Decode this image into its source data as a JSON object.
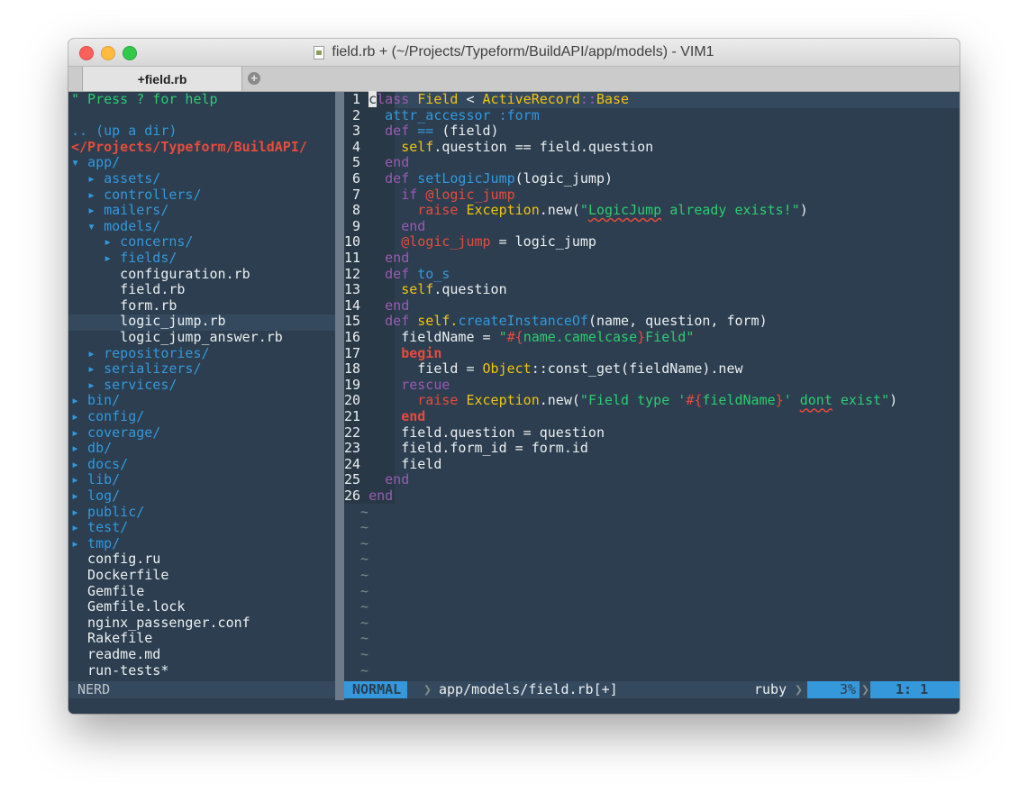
{
  "window": {
    "title": "field.rb + (~/Projects/Typeform/BuildAPI/app/models) - VIM1",
    "tab_label": "+field.rb",
    "add_tab_symbol": "+"
  },
  "tree": {
    "help": "\" Press ? for help",
    "up": ".. (up a dir)",
    "root": "</Projects/Typeform/BuildAPI/",
    "app": "▾ app/",
    "assets": "  ▸ assets/",
    "controllers": "  ▸ controllers/",
    "mailers": "  ▸ mailers/",
    "models": "  ▾ models/",
    "concerns": "    ▸ concerns/",
    "fields": "    ▸ fields/",
    "configuration": "      configuration.rb",
    "field": "      field.rb",
    "form": "      form.rb",
    "logic_jump": "      logic_jump.rb",
    "logic_jump_answer": "      logic_jump_answer.rb",
    "repositories": "  ▸ repositories/",
    "serializers": "  ▸ serializers/",
    "services": "  ▸ services/",
    "bin": "▸ bin/",
    "config": "▸ config/",
    "coverage": "▸ coverage/",
    "db": "▸ db/",
    "docs": "▸ docs/",
    "lib": "▸ lib/",
    "log": "▸ log/",
    "public": "▸ public/",
    "test": "▸ test/",
    "tmp": "▸ tmp/",
    "config_ru": "  config.ru",
    "dockerfile": "  Dockerfile",
    "gemfile": "  Gemfile",
    "gemfile_lock": "  Gemfile.lock",
    "nginx": "  nginx_passenger.conf",
    "rakefile": "  Rakefile",
    "readme": "  readme.md",
    "run_tests": "  run-tests*"
  },
  "code": {
    "ln": [
      " 1",
      " 2",
      " 3",
      " 4",
      " 5",
      " 6",
      " 7",
      " 8",
      " 9",
      "10",
      "11",
      "12",
      "13",
      "14",
      "15",
      "16",
      "17",
      "18",
      "19",
      "20",
      "21",
      "22",
      "23",
      "24",
      "25",
      "26"
    ],
    "t": {
      "sp1": " ",
      "sp2": "   ",
      "sp3": "     ",
      "sp4": "       ",
      "c": "c",
      "lass": "lass",
      "class_sp": " ",
      "field_cls": "Field",
      "lt": " < ",
      "ar": "ActiveRecord",
      "cc": "::",
      "base": "Base",
      "attr_accessor": "attr_accessor",
      "sym_form": ":form",
      "def": "def",
      "eqeq": "==",
      "field_arg": " (field)",
      "self": "self",
      "question_cmp": ".question == field.question",
      "end": "end",
      "setLogicJump": "setLogicJump",
      "logic_jump_arg": "(logic_jump)",
      "if": "if",
      "ivar_logic_jump": "@logic_jump",
      "raise": "raise",
      "exception": "Exception",
      "new_open": ".new(",
      "q": "\"",
      "LogicJump": "LogicJump",
      "already_exists": " already exists!",
      "close_paren": ")",
      "assign_logic_jump": " = logic_jump",
      "to_s": "to_s",
      "dot_question": ".question",
      "self_dot": "self.",
      "createInstanceOf": "createInstanceOf",
      "cio_args": "(name, question, form)",
      "fieldName_assign": "fieldName = ",
      "interp_open": "#{",
      "name_camelcase": "name.camelcase",
      "interp_close": "}",
      "Field_word": "Field",
      "begin": "begin",
      "field_assign": "field = ",
      "object": "Object",
      "const_get": "const_get(fieldName).new",
      "rescue": "rescue",
      "field_type": "Field type '",
      "fieldName_var": "fieldName",
      "quote_space": "' ",
      "dont": "dont",
      "exist": " exist",
      "field_question": "field.question = question",
      "field_form_id": "field.form_id = form.id",
      "field_ret": "field",
      "sp": " "
    },
    "tilde": "~"
  },
  "status": {
    "nerd": "NERD",
    "mode": "NORMAL",
    "sep": "❯",
    "file": "app/models/field.rb[+]",
    "filetype": "ruby",
    "percent": "3%",
    "position": "1:  1"
  }
}
